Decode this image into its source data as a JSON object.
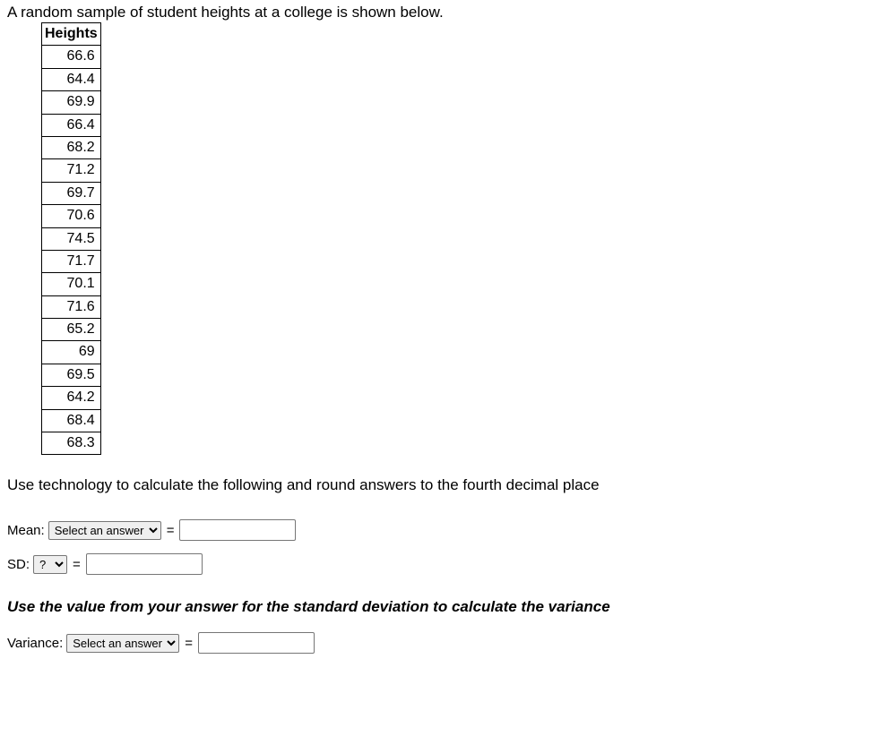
{
  "intro": "A random sample of student heights at a college is shown below.",
  "table": {
    "header": "Heights",
    "values": [
      "66.6",
      "64.4",
      "69.9",
      "66.4",
      "68.2",
      "71.2",
      "69.7",
      "70.6",
      "74.5",
      "71.7",
      "70.1",
      "71.6",
      "65.2",
      "69",
      "69.5",
      "64.2",
      "68.4",
      "68.3"
    ]
  },
  "instruction": "Use technology to calculate the following and round answers to the fourth decimal place",
  "mean": {
    "label": "Mean:",
    "select": "Select an answer",
    "eq": "="
  },
  "sd": {
    "label": "SD:",
    "select": "?",
    "eq": "="
  },
  "variance_instr": "Use the value from your answer for the standard deviation to calculate the variance",
  "variance": {
    "label": "Variance:",
    "select": "Select an answer",
    "eq": "="
  }
}
